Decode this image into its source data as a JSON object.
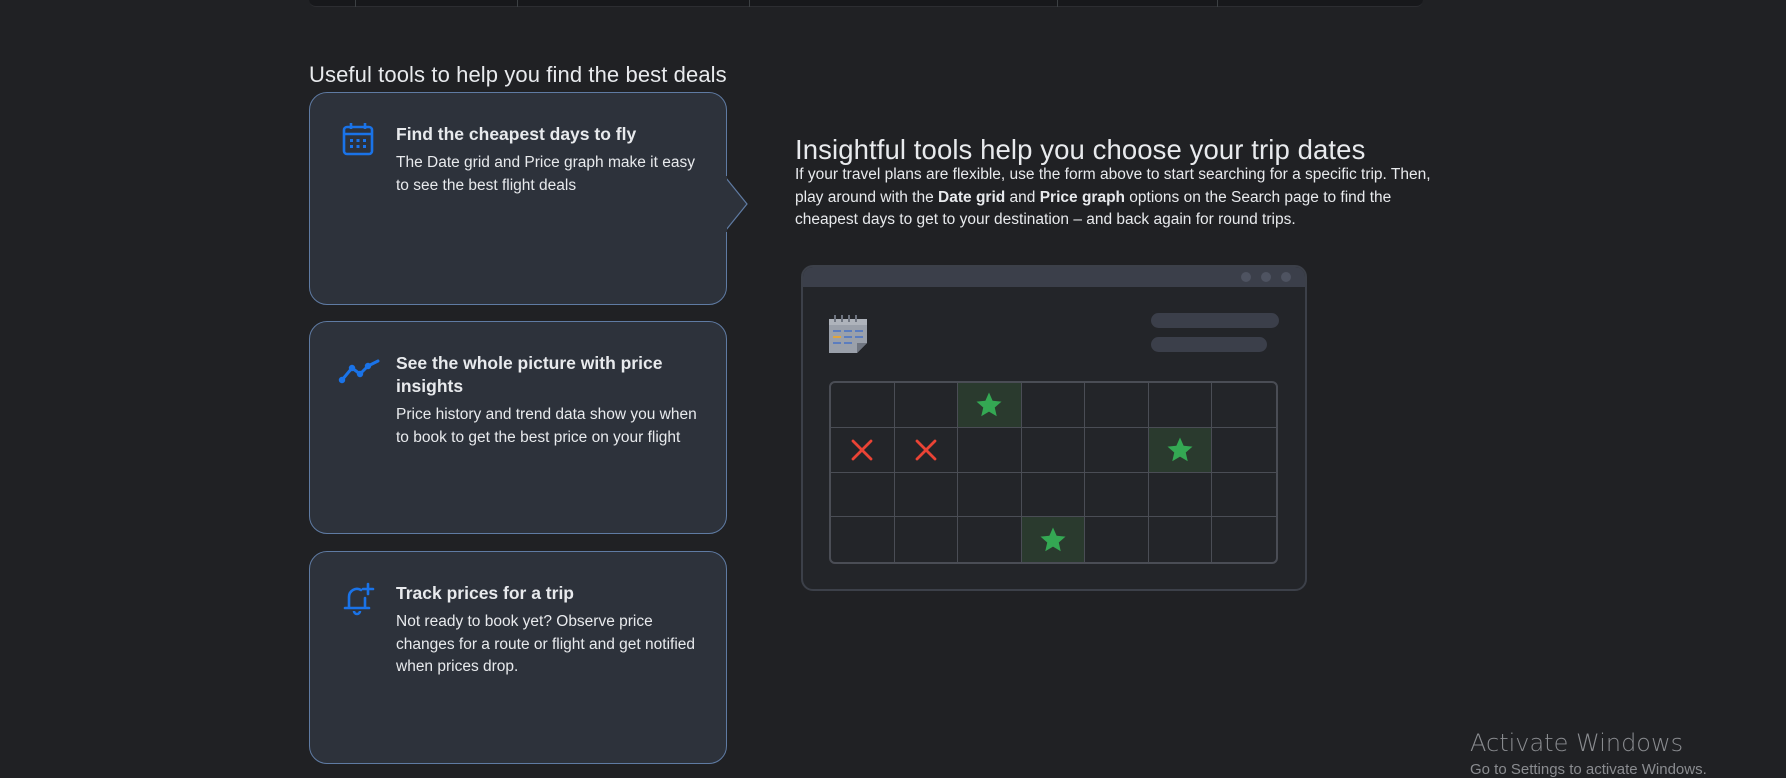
{
  "section": {
    "heading": "Useful tools to help you find the best deals"
  },
  "cards": [
    {
      "icon": "calendar-icon",
      "title": "Find the cheapest days to fly",
      "description": "The Date grid and Price graph make it easy to see the best flight deals"
    },
    {
      "icon": "trend-line-icon",
      "title": "See the whole picture with price insights",
      "description": "Price history and trend data show you when to book to get the best price on your flight"
    },
    {
      "icon": "bell-add-icon",
      "title": "Track prices for a trip",
      "description": "Not ready to book yet? Observe price changes for a route or flight and get notified when prices drop."
    }
  ],
  "detail": {
    "heading": "Insightful tools help you choose your trip dates",
    "body_part1": "If your travel plans are flexible, use the form above to start searching for a specific trip. Then, play around with the ",
    "body_bold1": "Date grid",
    "body_part2": " and ",
    "body_bold2": "Price graph",
    "body_part3": " options on the Search page to find the cheapest days to get to your destination – and back again for round trips."
  },
  "illustration": {
    "grid": [
      [
        "",
        "",
        "star",
        "",
        "",
        "",
        ""
      ],
      [
        "x",
        "x",
        "",
        "",
        "",
        "star",
        ""
      ],
      [
        "",
        "",
        "",
        "",
        "",
        "",
        ""
      ],
      [
        "",
        "",
        "",
        "star",
        "",
        "",
        ""
      ]
    ],
    "colors": {
      "star": "#34a853",
      "x": "#ea4335"
    }
  },
  "watermark": {
    "title": "Activate Windows",
    "subtitle": "Go to Settings to activate Windows."
  },
  "colors": {
    "background": "#202124",
    "card_background": "#2d323b",
    "card_border": "#5f7ba3",
    "icon_blue": "#1a73e8"
  }
}
